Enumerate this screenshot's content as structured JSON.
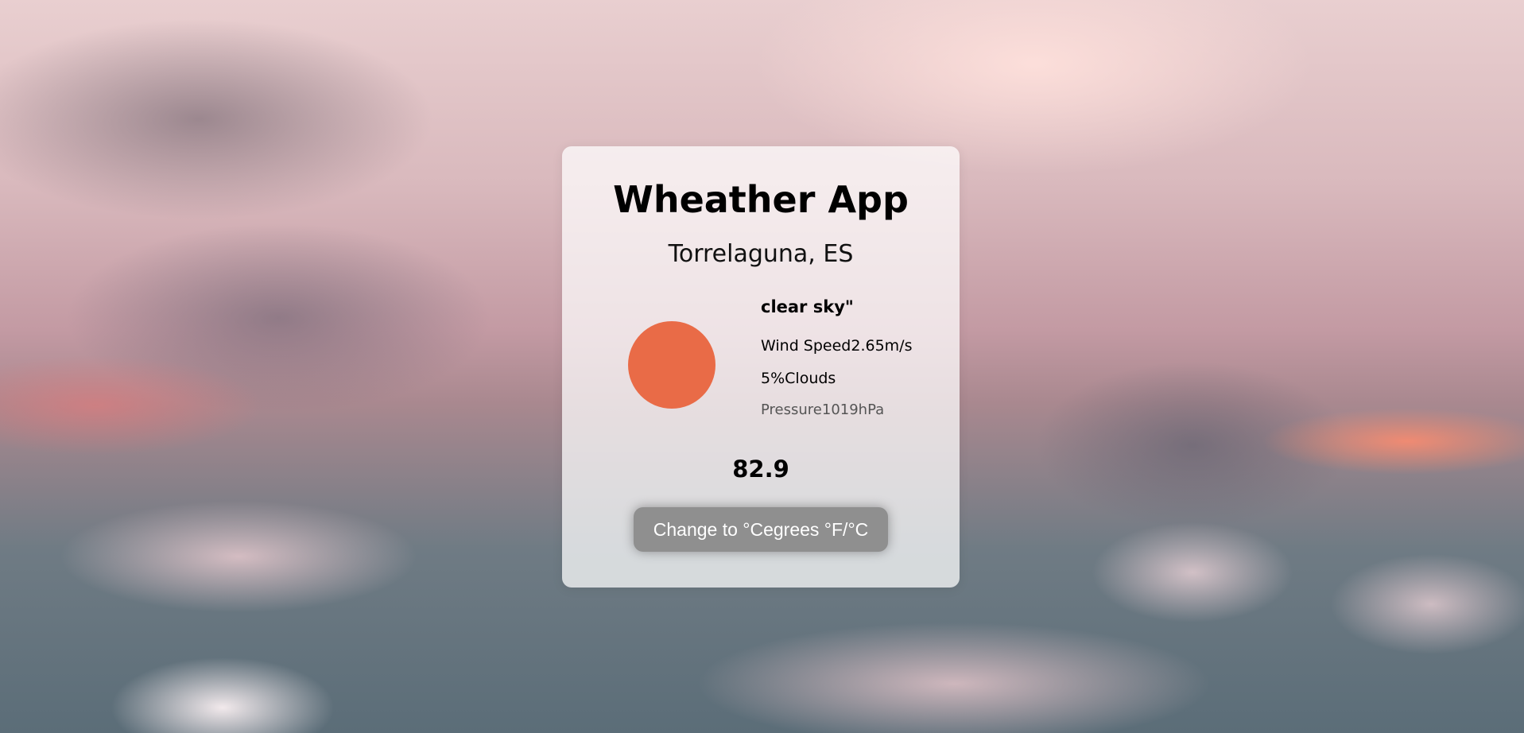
{
  "app": {
    "title": "Wheather App",
    "location": "Torrelaguna, ES"
  },
  "weather": {
    "description": "clear sky\"",
    "icon": "sun-icon",
    "wind_label": "Wind Speed",
    "wind_value": "2.65m/s",
    "clouds_value": "5%",
    "clouds_label": "Clouds",
    "pressure_label": "Pressure",
    "pressure_value": "1019hPa",
    "temperature": "82.9"
  },
  "controls": {
    "unit_button_label": "Change to °Cegrees °F/°C"
  },
  "colors": {
    "sun": "#e96b47",
    "button": "#8f8f8f"
  }
}
